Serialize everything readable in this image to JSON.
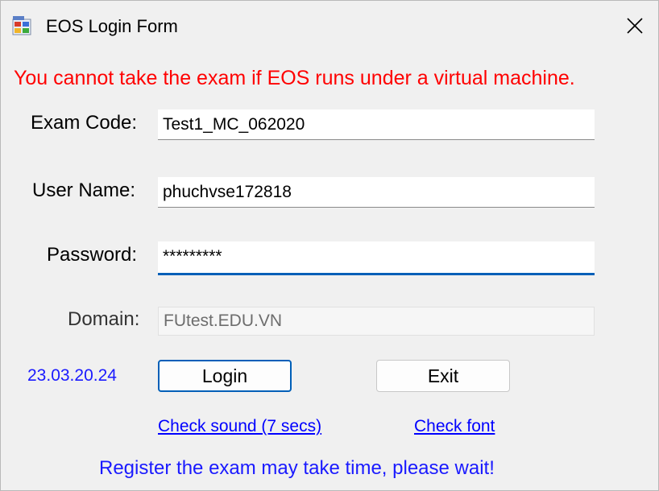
{
  "window": {
    "title": "EOS Login Form",
    "icon": "app-form-icon"
  },
  "warning_text": "You cannot take the exam if EOS runs under a virtual machine.",
  "form": {
    "exam_code": {
      "label": "Exam Code:",
      "value": "Test1_MC_062020"
    },
    "user_name": {
      "label": "User Name:",
      "value": "phuchvse172818"
    },
    "password": {
      "label": "Password:",
      "value": "*********"
    },
    "domain": {
      "label": "Domain:",
      "value": "FUtest.EDU.VN"
    }
  },
  "version": "23.03.20.24",
  "buttons": {
    "login": "Login",
    "exit": "Exit"
  },
  "links": {
    "check_sound": "Check sound (7 secs)",
    "check_font": "Check font"
  },
  "footer_message": "Register the exam may take time, please wait!",
  "colors": {
    "warning": "#ff0000",
    "info_blue": "#1a1aff",
    "link": "#0000ff",
    "focus_accent": "#005fb8"
  }
}
